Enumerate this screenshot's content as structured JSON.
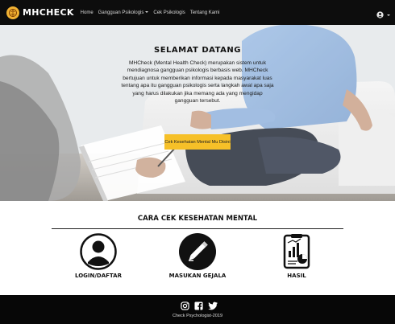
{
  "navbar": {
    "brand": "MHCHECK",
    "links": [
      {
        "label": "Home"
      },
      {
        "label": "Gangguan Psikologis"
      },
      {
        "label": "Cek Psikologis"
      },
      {
        "label": "Tentang Kami"
      }
    ],
    "icons": {
      "logo": "brain-logo-icon",
      "user": "user-icon",
      "caret": "chevron-down-icon"
    },
    "colors": {
      "background": "#0d0d0d",
      "logo": "#f2b233"
    }
  },
  "hero": {
    "title": "SELAMAT DATANG",
    "text": "MHCheck (Mental Health Check) merupakan sistem untuk mendiagnosa gangguan psikologis berbasis web. MHCheck bertujuan untuk memberikan informasi kepada masyarakat luas tentang apa itu gangguan psikologis serta langkah awal apa saja yang harus dilakukan jika memang ada yang mengidap gangguan tersebut.",
    "cta_label": "Cek Kesehatan Mental Mu Disini",
    "colors": {
      "cta": "#f6c028"
    }
  },
  "steps": {
    "title": "CARA CEK KESEHATAN MENTAL",
    "items": [
      {
        "label": "LOGIN/DAFTAR",
        "icon": "user-icon"
      },
      {
        "label": "MASUKAN GEJALA",
        "icon": "pencil-icon"
      },
      {
        "label": "HASIL",
        "icon": "report-icon"
      }
    ]
  },
  "footer": {
    "social": [
      {
        "icon": "instagram-icon"
      },
      {
        "icon": "facebook-icon"
      },
      {
        "icon": "twitter-icon"
      }
    ],
    "copyright": "Check Psychologist-2019"
  }
}
